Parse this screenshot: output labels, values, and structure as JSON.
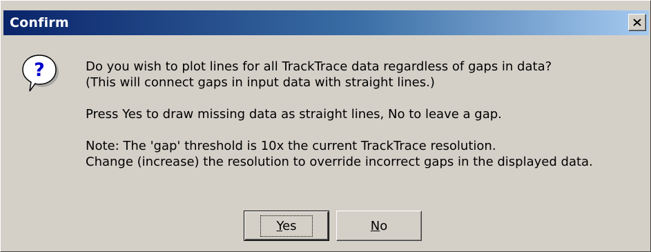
{
  "window": {
    "title": "Confirm",
    "close_glyph": "✕"
  },
  "icon": {
    "name": "question-icon",
    "glyph": "?"
  },
  "message": {
    "line1": "Do you wish to plot lines for all TrackTrace data regardless of gaps in data?",
    "line2": "(This will connect gaps in input data with straight lines.)",
    "line3": "Press Yes to draw missing data as straight lines, No to leave a gap.",
    "line4": "Note: The 'gap' threshold is 10x the current TrackTrace resolution.",
    "line5": "Change (increase) the resolution to override incorrect gaps in the displayed data."
  },
  "buttons": {
    "yes": {
      "accel": "Y",
      "rest": "es"
    },
    "no": {
      "accel": "N",
      "rest": "o"
    }
  }
}
